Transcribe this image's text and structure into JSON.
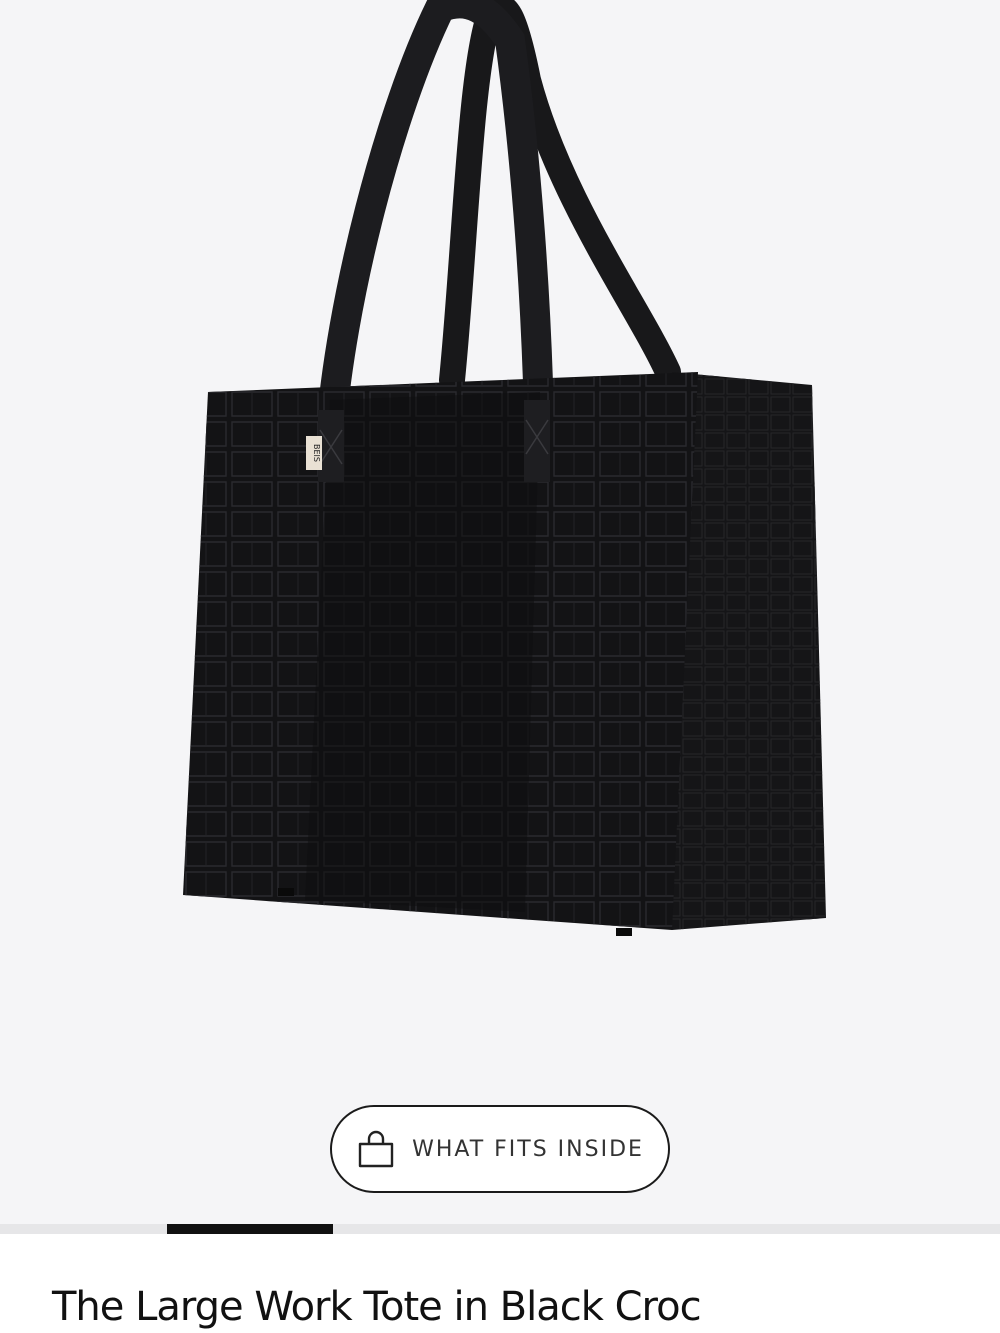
{
  "product": {
    "title": "The Large Work Tote in Black Croc",
    "image_alt": "Large Work Tote in Black Croc",
    "logo_text": "BEIS"
  },
  "fits_button": {
    "label": "WHAT FITS INSIDE",
    "icon": "shopping-bag-icon"
  },
  "gallery_progress": {
    "current_slide": 2,
    "total_slides": 6
  },
  "colors": {
    "gallery_background": "#f5f5f7",
    "bag": "#141416",
    "accent": "#111111",
    "track": "#e6e6e8"
  }
}
